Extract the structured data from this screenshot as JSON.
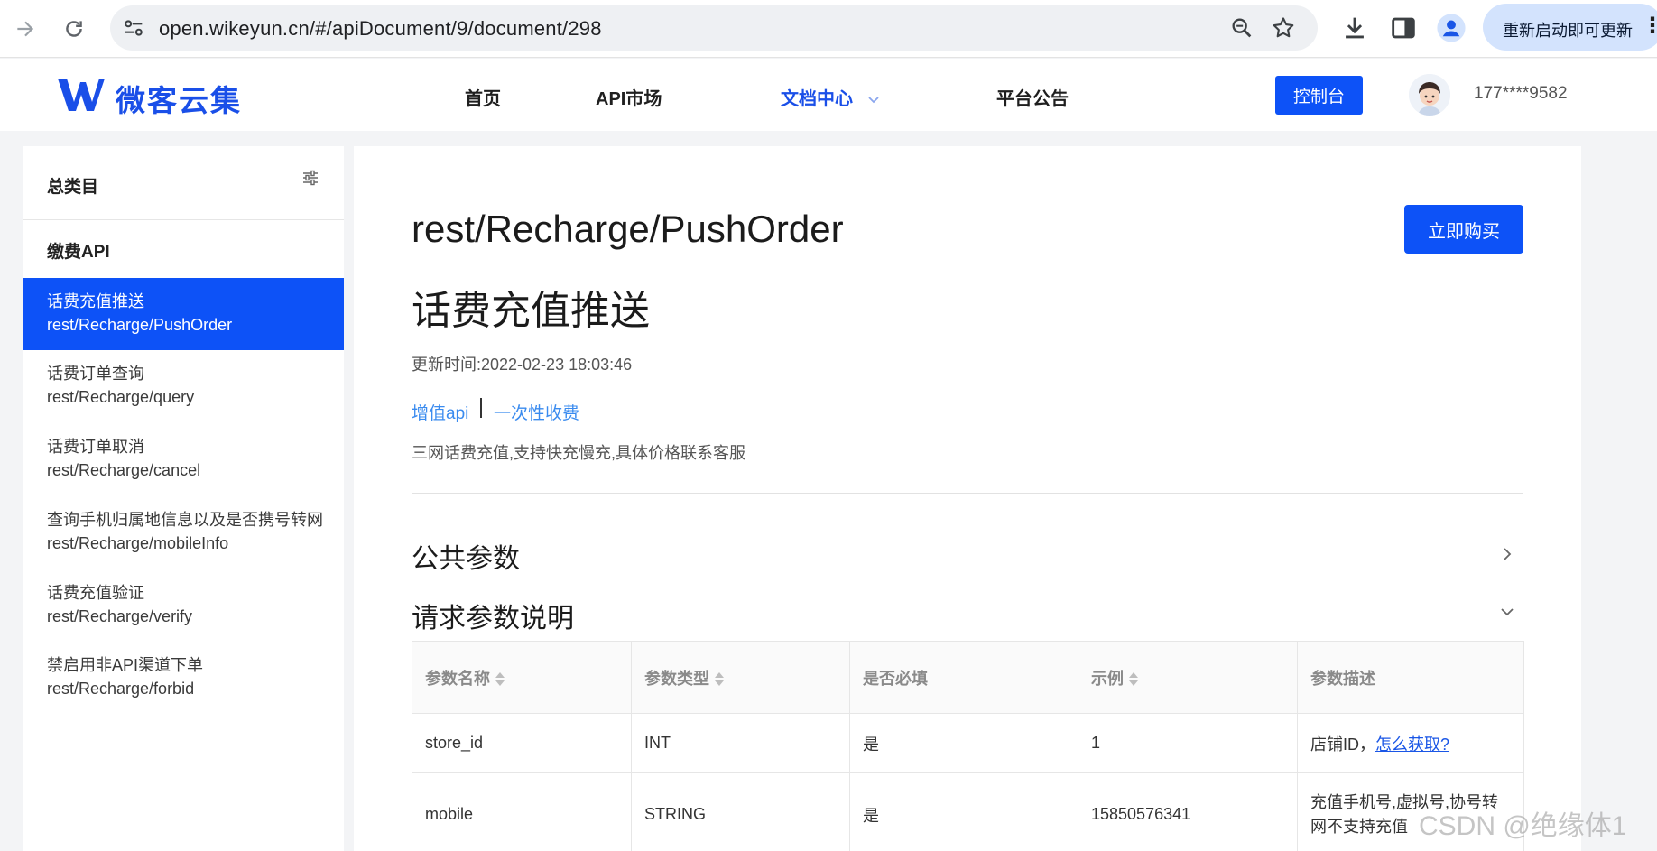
{
  "browser": {
    "url_host": "open.wikeyun.cn",
    "url_path": "/#/apiDocument/9/document/298",
    "update_label": "重新启动即可更新",
    "more_label": "⋮"
  },
  "header": {
    "logo_text": "微客云集",
    "menu": [
      {
        "label": "首页"
      },
      {
        "label": "API市场"
      },
      {
        "label": "文档中心"
      },
      {
        "label": "平台公告"
      }
    ],
    "console_label": "控制台",
    "phone": "177****9582"
  },
  "sidebar": {
    "title": "总类目",
    "group": "缴费API",
    "items": [
      {
        "name": "话费充值推送",
        "path": "rest/Recharge/PushOrder"
      },
      {
        "name": "话费订单查询",
        "path": "rest/Recharge/query"
      },
      {
        "name": "话费订单取消",
        "path": "rest/Recharge/cancel"
      },
      {
        "name": "查询手机归属地信息以及是否携号转网",
        "path": "rest/Recharge/mobileInfo"
      },
      {
        "name": "话费充值验证",
        "path": "rest/Recharge/verify"
      },
      {
        "name": "禁启用非API渠道下单",
        "path": "rest/Recharge/forbid"
      }
    ]
  },
  "main": {
    "api_path": "rest/Recharge/PushOrder",
    "buy_label": "立即购买",
    "api_title": "话费充值推送",
    "update_time": "更新时间:2022-02-23 18:03:46",
    "tag1": "增值api",
    "tag2": "一次性收费",
    "description": "三网话费充值,支持快充慢充,具体价格联系客服",
    "section_public": "公共参数",
    "section_request": "请求参数说明",
    "table": {
      "headers": [
        "参数名称",
        "参数类型",
        "是否必填",
        "示例",
        "参数描述"
      ],
      "rows": [
        {
          "name": "store_id",
          "type": "INT",
          "required": "是",
          "example": "1",
          "desc": "店铺ID，",
          "link": "怎么获取?"
        },
        {
          "name": "mobile",
          "type": "STRING",
          "required": "是",
          "example": "15850576341",
          "desc": "充值手机号,虚拟号,协号转网不支持充值"
        }
      ]
    }
  },
  "watermark": "CSDN @绝缘体1"
}
